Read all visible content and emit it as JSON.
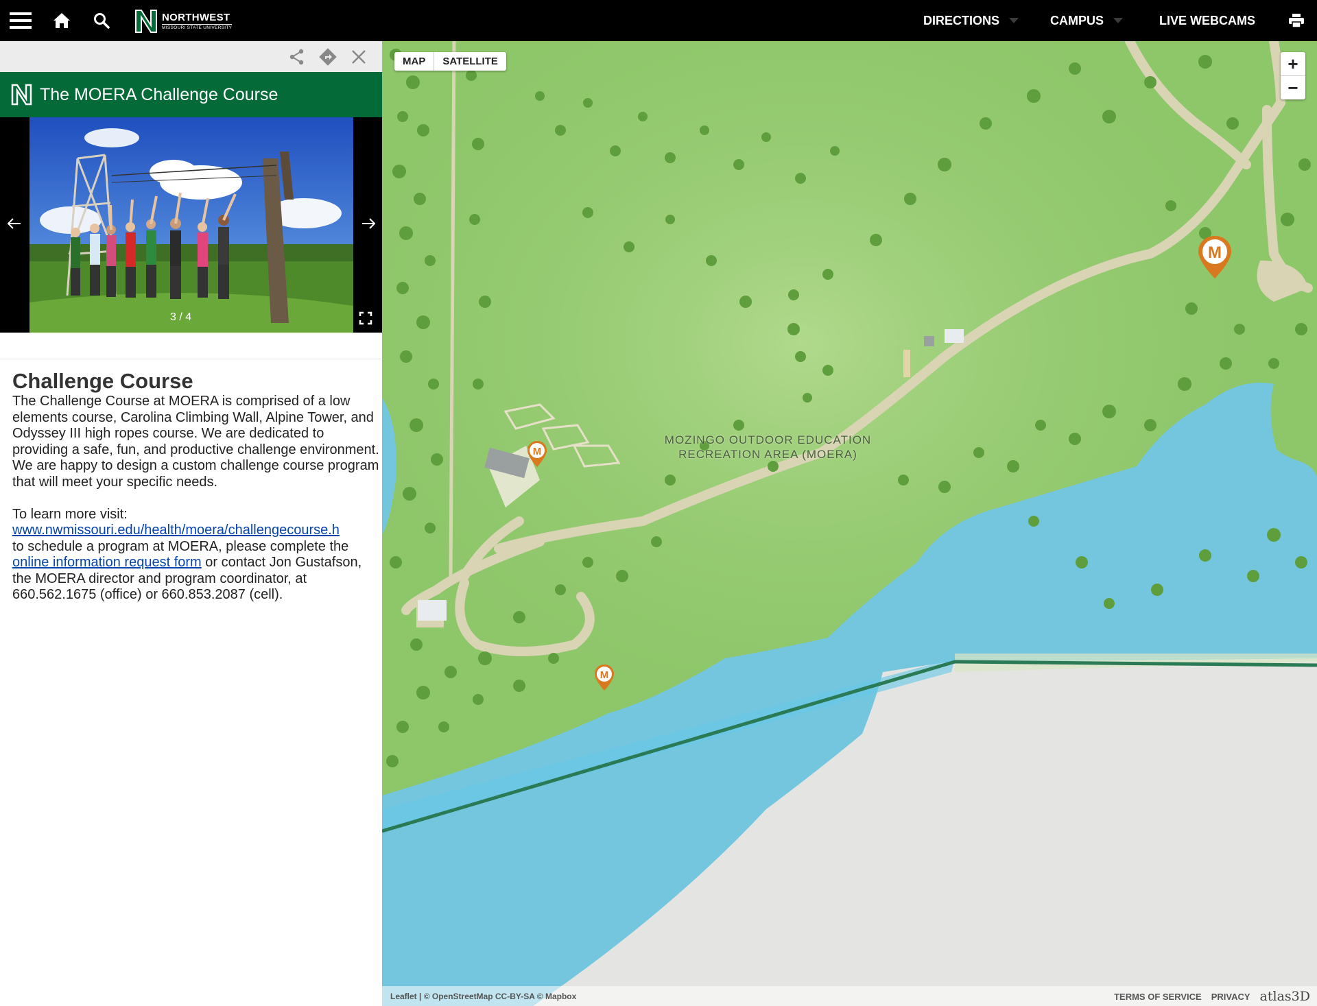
{
  "header": {
    "brand_name": "NORTHWEST",
    "brand_sub": "MISSOURI STATE UNIVERSITY",
    "nav": [
      {
        "label": "DIRECTIONS"
      },
      {
        "label": "CAMPUS"
      },
      {
        "label": "LIVE WEBCAMS"
      }
    ]
  },
  "panel": {
    "title": "The MOERA Challenge Course",
    "carousel": {
      "counter": "3 / 4"
    },
    "heading": "Challenge Course",
    "body": "The Challenge Course at MOERA is comprised of a low elements course, Carolina Climbing Wall, Alpine Tower, and Odyssey III high ropes course. We are dedicated to providing a safe, fun, and productive challenge environment. We are happy to design a custom challenge course program that will meet your specific needs.",
    "learn_more": "To learn more visit:",
    "url": "www.nwmissouri.edu/health/moera/challengecourse.h",
    "schedule_text": "to schedule a program at MOERA, please complete the",
    "form_link": "online information request form",
    "contact_text": "or contact Jon Gustafson, the MOERA director and program coordinator, at 660.562.1675 (office) or 660.853.2087 (cell)."
  },
  "map": {
    "type_buttons": [
      "MAP",
      "SATELLITE"
    ],
    "zoom_in": "+",
    "zoom_out": "−",
    "area_label": "MOZINGO OUTDOOR EDUCATION RECREATION AREA (MOERA)",
    "marker_letter": "M",
    "attribution_left": "Leaflet | © OpenStreetMap CC-BY-SA © Mapbox",
    "terms": "TERMS OF SERVICE",
    "privacy": "PRIVACY",
    "credit": "atlas3D"
  },
  "colors": {
    "brand_green": "#046a38",
    "marker_orange": "#d9791f",
    "water": "#72cceb",
    "land": "#8ec66a",
    "road": "#d6d3b4"
  }
}
